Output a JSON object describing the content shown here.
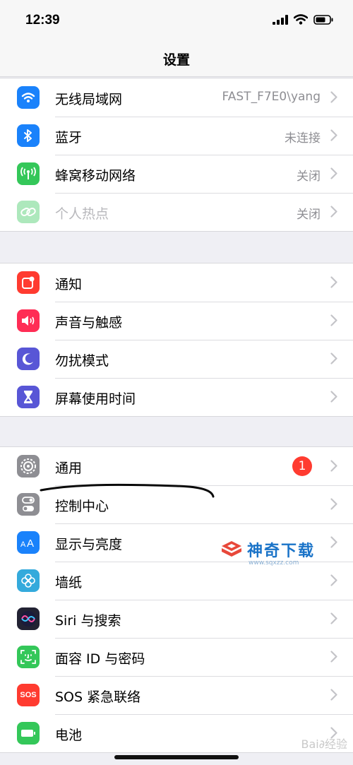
{
  "status": {
    "time": "12:39"
  },
  "nav": {
    "title": "设置"
  },
  "groups": [
    [
      {
        "name": "wifi",
        "icon": "wifi-icon",
        "color": "#1a82fb",
        "label": "无线局域网",
        "value": "FAST_F7E0\\yang"
      },
      {
        "name": "bluetooth",
        "icon": "bluetooth-icon",
        "color": "#1a82fb",
        "label": "蓝牙",
        "value": "未连接"
      },
      {
        "name": "cellular",
        "icon": "antenna-icon",
        "color": "#34c759",
        "label": "蜂窝移动网络",
        "value": "关闭"
      },
      {
        "name": "hotspot",
        "icon": "link-icon",
        "color": "#34c759",
        "label": "个人热点",
        "value": "关闭",
        "disabled": true
      }
    ],
    [
      {
        "name": "notifications",
        "icon": "notification-icon",
        "color": "#ff3b30",
        "label": "通知"
      },
      {
        "name": "sounds",
        "icon": "speaker-icon",
        "color": "#ff2d55",
        "label": "声音与触感"
      },
      {
        "name": "dnd",
        "icon": "moon-icon",
        "color": "#5856d6",
        "label": "勿扰模式"
      },
      {
        "name": "screentime",
        "icon": "hourglass-icon",
        "color": "#5856d6",
        "label": "屏幕使用时间"
      }
    ],
    [
      {
        "name": "general",
        "icon": "gear-icon",
        "color": "#8e8e93",
        "label": "通用",
        "badge": "1"
      },
      {
        "name": "control-center",
        "icon": "toggle-icon",
        "color": "#8e8e93",
        "label": "控制中心"
      },
      {
        "name": "display",
        "icon": "text-size-icon",
        "color": "#1a82fb",
        "label": "显示与亮度"
      },
      {
        "name": "wallpaper",
        "icon": "flower-icon",
        "color": "#34aadc",
        "label": "墙纸"
      },
      {
        "name": "siri",
        "icon": "siri-icon",
        "color": "#222233",
        "label": "Siri 与搜索"
      },
      {
        "name": "faceid",
        "icon": "face-id-icon",
        "color": "#34c759",
        "label": "面容 ID 与密码"
      },
      {
        "name": "sos",
        "icon": "sos-icon",
        "color": "#ff3b30",
        "label": "SOS 紧急联络",
        "icon_text": "SOS"
      },
      {
        "name": "battery",
        "icon": "battery-icon",
        "color": "#34c759",
        "label": "电池"
      }
    ]
  ],
  "watermark": {
    "text": "神奇下载",
    "url": "www.sqxzz.com"
  },
  "baidu_mark": "Bai∂经验"
}
